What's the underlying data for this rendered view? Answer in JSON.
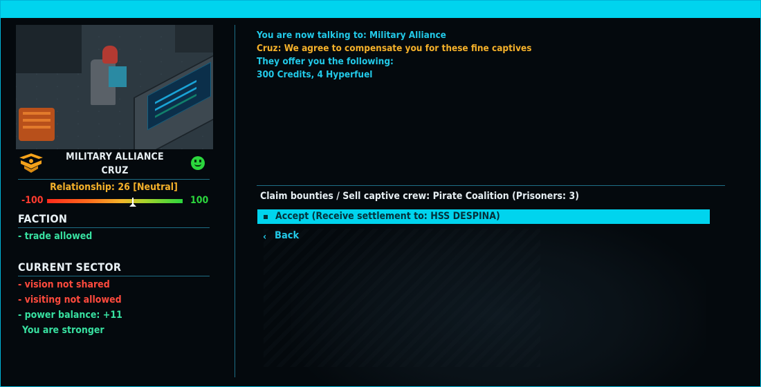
{
  "colors": {
    "accent": "#00d4ee",
    "cyan_text": "#22c9e8",
    "orange_text": "#f5b12a",
    "green": "#2bd63d",
    "red": "#ff4a3d"
  },
  "portrait": {
    "icon": "captain-portrait-image"
  },
  "faction": {
    "emblem_icon": "military-alliance-emblem-icon",
    "name": "MILITARY ALLIANCE",
    "captain": "CRUZ",
    "mood_icon": "smiley-face-icon"
  },
  "relationship": {
    "label": "Relationship: 26 [Neutral]",
    "min_label": "-100",
    "max_label": "100",
    "value": 26,
    "min": -100,
    "max": 100
  },
  "faction_section": {
    "title": "FACTION",
    "items": [
      "- trade allowed"
    ]
  },
  "sector_section": {
    "title": "CURRENT SECTOR",
    "items": [
      "- vision not shared",
      "- visiting not allowed",
      "- power balance: +11",
      "You are stronger"
    ]
  },
  "dialogue": {
    "line1": "You are now talking to: Military Alliance",
    "line2": "Cruz: We agree to compensate you for these fine captives",
    "line3": "They offer you the following:",
    "line4": "300 Credits, 4 Hyperfuel"
  },
  "options": {
    "title": "Claim bounties / Sell captive crew: Pirate Coalition (Prisoners: 3)",
    "accept_label": "Accept (Receive settlement to: HSS DESPINA)",
    "back_label": "Back",
    "back_icon": "chevron-left-icon"
  }
}
